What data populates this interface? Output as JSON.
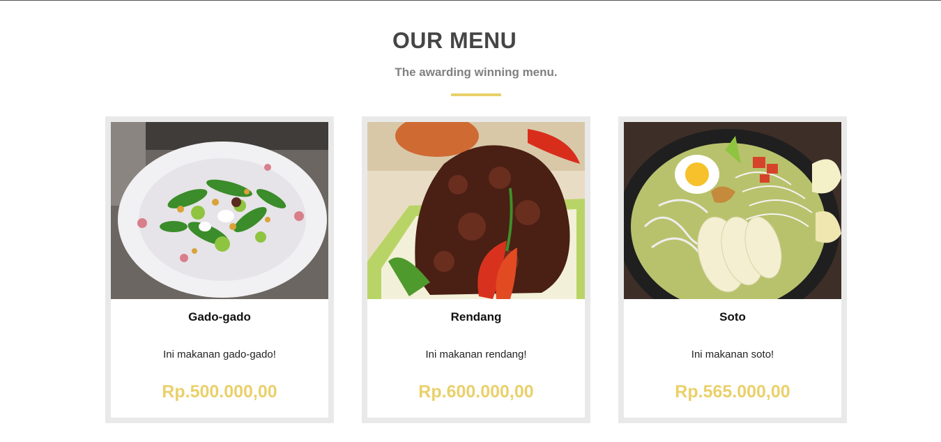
{
  "section": {
    "title": "OUR MENU",
    "subtitle": "The awarding winning menu.",
    "accent_color": "#e9d16a"
  },
  "menu": {
    "items": [
      {
        "name": "Gado-gado",
        "description": "Ini makanan gado-gado!",
        "price": "Rp.500.000,00",
        "image": "gado-gado-photo"
      },
      {
        "name": "Rendang",
        "description": "Ini makanan rendang!",
        "price": "Rp.600.000,00",
        "image": "rendang-photo"
      },
      {
        "name": "Soto",
        "description": "Ini makanan soto!",
        "price": "Rp.565.000,00",
        "image": "soto-photo"
      }
    ]
  }
}
